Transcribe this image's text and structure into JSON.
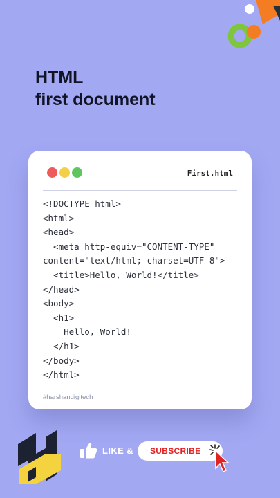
{
  "heading": {
    "line1": "HTML",
    "line2": "first document"
  },
  "editor": {
    "filename": "First.html",
    "code_lines": [
      "<!DOCTYPE html>",
      "<html>",
      "<head>",
      "  <meta http-equiv=\"CONTENT-TYPE\"",
      "content=\"text/html; charset=UTF-8\">",
      "  <title>Hello, World!</title>",
      "</head>",
      "<body>",
      "  <h1>",
      "    Hello, World!",
      "  </h1>",
      "</body>",
      "</html>"
    ],
    "hashtag": "#harshandigitech"
  },
  "footer": {
    "like_label": "LIKE &",
    "subscribe_label": "SUBSCRIBE"
  },
  "colors": {
    "background": "#a2a8f2",
    "window_red": "#ef5b5b",
    "window_yellow": "#f4cf49",
    "window_green": "#5fc55d",
    "subscribe_text": "#e02323",
    "deco_orange": "#f47c22",
    "deco_green": "#7fc63c"
  },
  "icons": [
    "window-close-dot",
    "window-minimize-dot",
    "window-maximize-dot",
    "thumbs-up-icon",
    "cursor-click-icon",
    "brand-logo-icon"
  ]
}
